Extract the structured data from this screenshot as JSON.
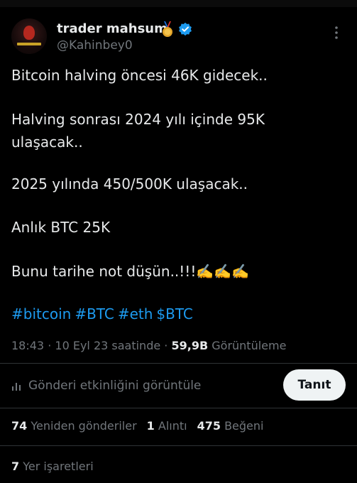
{
  "tweet": {
    "display_name": "trader mahsum",
    "handle": "@Kahinbey0",
    "lines": [
      "Bitcoin halving öncesi  46K gidecek..",
      "Halving sonrası 2024 yılı içinde 95K",
      "ulaşacak..",
      "2025 yılında  450/500K ulaşacak..",
      "Anlık BTC 25K",
      "Bunu tarihe not düşün..!!!✍️✍️✍️"
    ],
    "hashtags": [
      "#bitcoin",
      "#BTC",
      "#eth",
      "$BTC"
    ],
    "time": "18:43",
    "date": "10 Eyl 23 saatinde",
    "views_count": "59,9B",
    "views_label": "Görüntüleme",
    "separator": "·"
  },
  "activity": {
    "label": "Gönderi etkinliğini görüntüle",
    "promote_label": "Tanıt"
  },
  "stats": {
    "retweets_count": "74",
    "retweets_label": "Yeniden gönderiler",
    "quotes_count": "1",
    "quotes_label": "Alıntı",
    "likes_count": "475",
    "likes_label": "Beğeni",
    "bookmarks_count": "7",
    "bookmarks_label": "Yer işaretleri"
  },
  "icons": {
    "medal": "medal-icon",
    "verified": "verified-badge-icon",
    "more": "more-options-icon",
    "analytics": "analytics-icon"
  },
  "colors": {
    "background": "#000000",
    "text": "#e7e9ea",
    "muted": "#71767b",
    "link": "#1d9bf0",
    "verified": "#1d9bf0",
    "button_bg": "#eff3f4",
    "divider": "#2f3336"
  }
}
